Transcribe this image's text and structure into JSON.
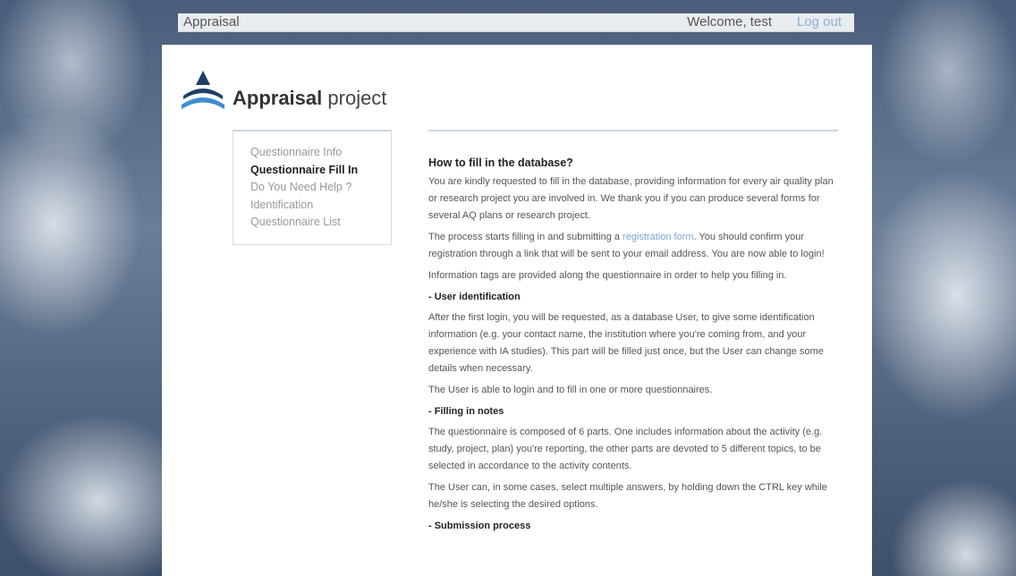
{
  "topbar": {
    "app_name": "Appraisal",
    "welcome": "Welcome, test",
    "logout": "Log out"
  },
  "brand": {
    "bold": "Appraisal",
    "light": "project",
    "logo_icon": "appraisal-logo-icon"
  },
  "sidenav": {
    "items": [
      {
        "label": "Questionnaire Info",
        "active": false
      },
      {
        "label": "Questionnaire Fill In",
        "active": true
      },
      {
        "label": "Do You Need Help ?",
        "active": false
      },
      {
        "label": "Identification",
        "active": false
      },
      {
        "label": "Questionnaire List",
        "active": false
      }
    ]
  },
  "content": {
    "title": "How to fill in the database?",
    "p1": "You are kindly requested to fill in the database, providing information for every air quality plan or research project you are involved in. We thank you if you can produce several forms for several AQ plans or research project.",
    "p2_before": "The process starts filling in and submitting a ",
    "p2_link": "registration form",
    "p2_after": ". You should confirm your registration through a link that will be sent to your email address. You are now able to login!",
    "p3": "Information tags are provided along the questionnaire in order to help you filling in.",
    "h_user": "- User identification",
    "p4": "After the first login, you will be requested, as a database User, to give some identification information (e.g. your contact name, the institution where you're coming from, and your experience with IA studies). This part will be filled just once, but the User can change some details when necessary.",
    "p5": "The User is able to login and to fill in one or more questionnaires.",
    "h_filling": "- Filling in notes",
    "p6": "The questionnaire is composed of 6 parts. One includes information about the activity (e.g. study, project, plan) you're reporting, the other parts are devoted to 5 different topics, to be selected in accordance to the activity contents.",
    "p7": "The User can, in some cases, select multiple answers, by holding down the CTRL key while he/she is selecting the desired options.",
    "h_submission": "- Submission process"
  },
  "colors": {
    "accent": "#7aa6d0",
    "logo_dark": "#1e3f66",
    "logo_light": "#3f8ed0"
  }
}
